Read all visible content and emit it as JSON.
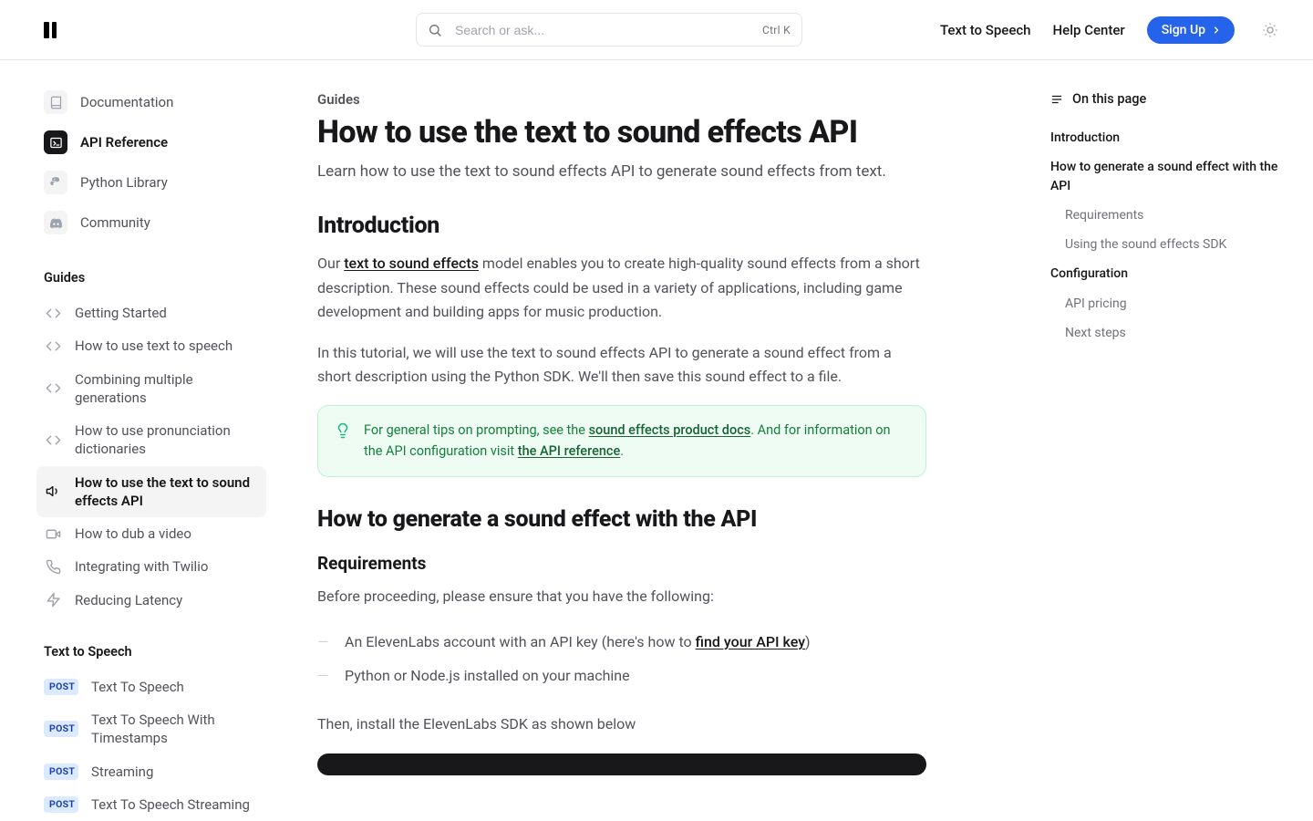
{
  "header": {
    "search_placeholder": "Search or ask...",
    "search_shortcut": "Ctrl K",
    "nav": {
      "tts": "Text to Speech",
      "help": "Help Center",
      "signup": "Sign Up"
    }
  },
  "sidebar": {
    "top": [
      {
        "label": "Documentation",
        "icon": "book"
      },
      {
        "label": "API Reference",
        "icon": "terminal",
        "active": true
      },
      {
        "label": "Python Library",
        "icon": "python"
      },
      {
        "label": "Community",
        "icon": "discord"
      }
    ],
    "sections": [
      {
        "title": "Guides",
        "items": [
          {
            "icon": "code",
            "label": "Getting Started"
          },
          {
            "icon": "code",
            "label": "How to use text to speech"
          },
          {
            "icon": "code",
            "label": "Combining multiple generations"
          },
          {
            "icon": "code",
            "label": "How to use pronunciation dictionaries"
          },
          {
            "icon": "speaker",
            "label": "How to use the text to sound effects API",
            "active": true
          },
          {
            "icon": "video",
            "label": "How to dub a video"
          },
          {
            "icon": "phone",
            "label": "Integrating with Twilio"
          },
          {
            "icon": "zap",
            "label": "Reducing Latency"
          }
        ]
      },
      {
        "title": "Text to Speech",
        "items": [
          {
            "badge": "POST",
            "label": "Text To Speech"
          },
          {
            "badge": "POST",
            "label": "Text To Speech With Timestamps"
          },
          {
            "badge": "POST",
            "label": "Streaming"
          },
          {
            "badge": "POST",
            "label": "Text To Speech Streaming"
          }
        ]
      }
    ]
  },
  "content": {
    "eyebrow": "Guides",
    "title": "How to use the text to sound effects API",
    "subtitle": "Learn how to use the text to sound effects API to generate sound effects from text.",
    "intro_heading": "Introduction",
    "intro_p1_a": "Our ",
    "intro_p1_link": "text to sound effects",
    "intro_p1_b": " model enables you to create high-quality sound effects from a short description. These sound effects could be used in a variety of applications, including game development and building apps for music production.",
    "intro_p2": "In this tutorial, we will use the text to sound effects API to generate a sound effect from a short description using the Python SDK. We'll then save this sound effect to a file.",
    "callout_a": "For general tips on prompting, see the ",
    "callout_link1": "sound effects product docs",
    "callout_b": ". And for information on the API configuration visit ",
    "callout_link2": "the API reference",
    "callout_c": ".",
    "howto_heading": "How to generate a sound effect with the API",
    "req_heading": "Requirements",
    "req_intro": "Before proceeding, please ensure that you have the following:",
    "req1_a": "An ElevenLabs account with an API key (here's how to ",
    "req1_link": "find your API key",
    "req1_b": ")",
    "req2": "Python or Node.js installed on your machine",
    "install": "Then, install the ElevenLabs SDK as shown below"
  },
  "toc": {
    "title": "On this page",
    "items": [
      {
        "label": "Introduction",
        "level": 1
      },
      {
        "label": "How to generate a sound effect with the API",
        "level": 1
      },
      {
        "label": "Requirements",
        "level": 2
      },
      {
        "label": "Using the sound effects SDK",
        "level": 2
      },
      {
        "label": "Configuration",
        "level": 1
      },
      {
        "label": "API pricing",
        "level": 2
      },
      {
        "label": "Next steps",
        "level": 2
      }
    ]
  }
}
